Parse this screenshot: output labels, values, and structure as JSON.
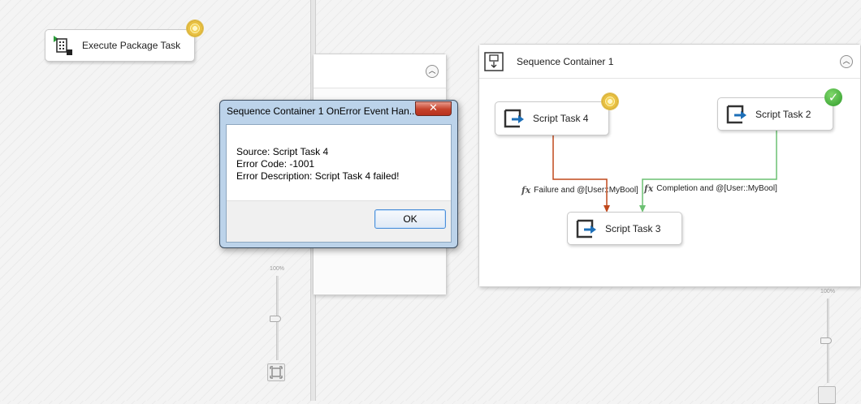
{
  "left_canvas": {
    "execute_task": {
      "label": "Execute Package Task",
      "status_icon": "pending-status-icon"
    },
    "zoom": {
      "percent": "100%"
    }
  },
  "right_canvas": {
    "container": {
      "title": "Sequence Container 1",
      "collapse_glyph": "︿"
    },
    "tasks": [
      {
        "id": "script-task-4",
        "label": "Script Task 4",
        "status": "pending"
      },
      {
        "id": "script-task-2",
        "label": "Script Task 2",
        "status": "success"
      },
      {
        "id": "script-task-3",
        "label": "Script Task 3",
        "status": "none"
      }
    ],
    "constraints": [
      {
        "fx": "fx",
        "label": "Failure and @[User::MyBool]",
        "color": "#c0481c"
      },
      {
        "fx": "fx",
        "label": "Completion and @[User::MyBool]",
        "color": "#6cc072"
      }
    ],
    "zoom": {
      "percent": "100%"
    }
  },
  "dialog": {
    "title": "Sequence Container 1 OnError Event Han...",
    "close_glyph": "✕",
    "source": "Source: Script Task 4",
    "error_code": "Error Code: -1001",
    "error_description": "Error Description: Script Task 4 failed!",
    "ok_label": "OK"
  },
  "background_container": {
    "collapse_glyph": "︿"
  },
  "colors": {
    "failure": "#c0481c",
    "completion": "#6cc072",
    "success_badge": "#2f9a2a",
    "dialog_frame": "#bcd3ea"
  }
}
